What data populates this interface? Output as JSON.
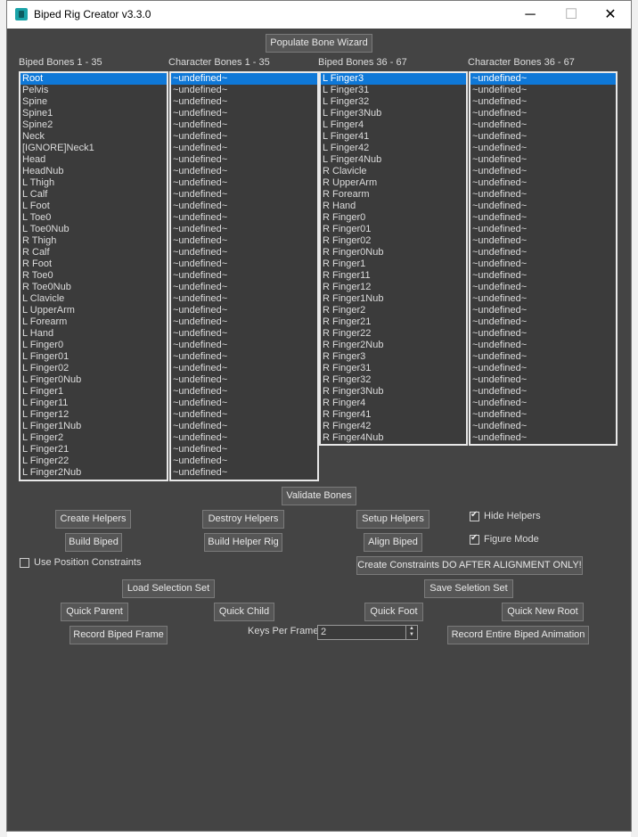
{
  "window": {
    "title": "Biped Rig Creator v3.3.0",
    "minimize_glyph": "─",
    "maximize_glyph": "☐",
    "close_glyph": "✕"
  },
  "buttons": {
    "populate": "Populate Bone Wizard",
    "validate": "Validate Bones",
    "create_helpers": "Create Helpers",
    "destroy_helpers": "Destroy Helpers",
    "setup_helpers": "Setup Helpers",
    "build_biped": "Build Biped",
    "build_helper_rig": "Build Helper Rig",
    "align_biped": "Align Biped",
    "create_constraints": "Create Constraints DO AFTER ALIGNMENT ONLY!",
    "load_selection_set": "Load Selection Set",
    "save_selection_set": "Save Seletion Set",
    "quick_parent": "Quick Parent",
    "quick_child": "Quick Child",
    "quick_foot": "Quick Foot",
    "quick_new_root": "Quick New Root",
    "record_biped_frame": "Record Biped Frame",
    "record_entire": "Record Entire Biped Animation"
  },
  "checkboxes": {
    "hide_helpers": {
      "label": "Hide Helpers",
      "checked": true
    },
    "figure_mode": {
      "label": "Figure Mode",
      "checked": true
    },
    "use_position_constraints": {
      "label": "Use Position Constraints",
      "checked": false
    }
  },
  "keys_per_frame": {
    "label": "Keys Per Frame",
    "value": "2"
  },
  "lists": [
    {
      "header": "Biped Bones 1 - 35",
      "selected": 0,
      "items": [
        "Root",
        "Pelvis",
        "Spine",
        "Spine1",
        "Spine2",
        "Neck",
        "[IGNORE]Neck1",
        "Head",
        "HeadNub",
        "L Thigh",
        "L Calf",
        "L Foot",
        "L Toe0",
        "L Toe0Nub",
        "R Thigh",
        "R Calf",
        "R Foot",
        "R Toe0",
        "R Toe0Nub",
        "L Clavicle",
        "L UpperArm",
        "L Forearm",
        "L Hand",
        "L Finger0",
        "L Finger01",
        "L Finger02",
        "L Finger0Nub",
        "L Finger1",
        "L Finger11",
        "L Finger12",
        "L Finger1Nub",
        "L Finger2",
        "L Finger21",
        "L Finger22",
        "L Finger2Nub"
      ]
    },
    {
      "header": "Character Bones 1 - 35",
      "selected": 0,
      "items": [
        "~undefined~",
        "~undefined~",
        "~undefined~",
        "~undefined~",
        "~undefined~",
        "~undefined~",
        "~undefined~",
        "~undefined~",
        "~undefined~",
        "~undefined~",
        "~undefined~",
        "~undefined~",
        "~undefined~",
        "~undefined~",
        "~undefined~",
        "~undefined~",
        "~undefined~",
        "~undefined~",
        "~undefined~",
        "~undefined~",
        "~undefined~",
        "~undefined~",
        "~undefined~",
        "~undefined~",
        "~undefined~",
        "~undefined~",
        "~undefined~",
        "~undefined~",
        "~undefined~",
        "~undefined~",
        "~undefined~",
        "~undefined~",
        "~undefined~",
        "~undefined~",
        "~undefined~"
      ]
    },
    {
      "header": "Biped Bones 36 - 67",
      "selected": 0,
      "items": [
        "L Finger3",
        "L Finger31",
        "L Finger32",
        "L Finger3Nub",
        "L Finger4",
        "L Finger41",
        "L Finger42",
        "L Finger4Nub",
        "R  Clavicle",
        "R  UpperArm",
        "R  Forearm",
        "R  Hand",
        "R  Finger0",
        "R  Finger01",
        "R  Finger02",
        "R  Finger0Nub",
        "R  Finger1",
        "R  Finger11",
        "R  Finger12",
        "R  Finger1Nub",
        "R  Finger2",
        "R  Finger21",
        "R  Finger22",
        "R  Finger2Nub",
        "R  Finger3",
        "R  Finger31",
        "R  Finger32",
        "R  Finger3Nub",
        "R  Finger4",
        "R  Finger41",
        "R  Finger42",
        "R  Finger4Nub"
      ]
    },
    {
      "header": "Character Bones 36 - 67",
      "selected": 0,
      "items": [
        "~undefined~",
        "~undefined~",
        "~undefined~",
        "~undefined~",
        "~undefined~",
        "~undefined~",
        "~undefined~",
        "~undefined~",
        "~undefined~",
        "~undefined~",
        "~undefined~",
        "~undefined~",
        "~undefined~",
        "~undefined~",
        "~undefined~",
        "~undefined~",
        "~undefined~",
        "~undefined~",
        "~undefined~",
        "~undefined~",
        "~undefined~",
        "~undefined~",
        "~undefined~",
        "~undefined~",
        "~undefined~",
        "~undefined~",
        "~undefined~",
        "~undefined~",
        "~undefined~",
        "~undefined~",
        "~undefined~",
        "~undefined~"
      ]
    }
  ]
}
